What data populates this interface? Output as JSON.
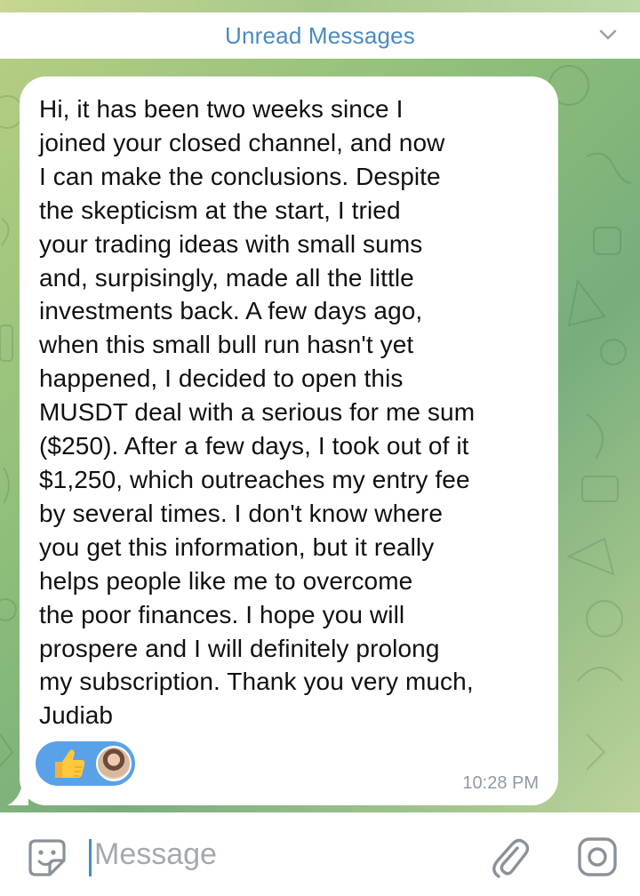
{
  "header": {
    "unread_label": "Unread Messages",
    "chevron_icon": "chevron-down-icon"
  },
  "message": {
    "text": "Hi, it has been two weeks since I\njoined your closed channel, and now\nI can make the conclusions. Despite\nthe skepticism at the start, I tried\nyour trading ideas with small sums\nand, surpisingly, made all the little\ninvestments back. A few days ago,\nwhen this small bull run hasn't yet\nhappened, I decided to open this\nMUSDT deal with a serious for me sum\n($250). After a few days, I took out of it\n$1,250, which outreaches my entry fee\nby several times. I don't know where\nyou get this information, but it really\nhelps people like me to overcome\nthe poor finances. I hope you will\nprospere and I will definitely prolong\nmy subscription. Thank you very much,\nJudiab",
    "time": "10:28 PM",
    "reaction_emoji": "thumbs-up-icon",
    "reaction_avatar": "reactor-avatar"
  },
  "composer": {
    "placeholder": "Message",
    "sticker_icon": "sticker-icon",
    "attach_icon": "paperclip-icon",
    "camera_icon": "camera-icon"
  },
  "colors": {
    "accent": "#4a8bc2",
    "reaction_bg": "#5aa2e8",
    "timestamp": "#8e9aa5",
    "placeholder": "#a3a9ae"
  }
}
